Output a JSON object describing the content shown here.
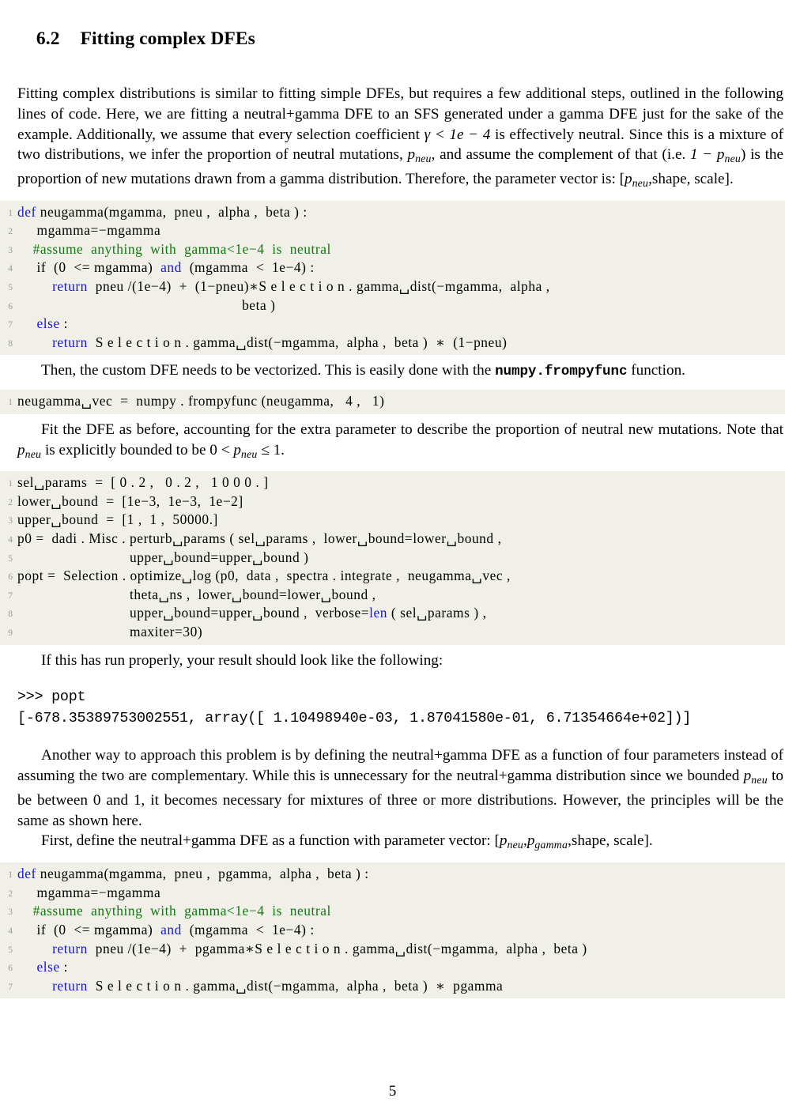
{
  "document": {
    "page_number": "5"
  },
  "section": {
    "number": "6.2",
    "title": "Fitting complex DFEs"
  },
  "paragraphs": {
    "intro_p1": "Fitting complex distributions is similar to fitting simple DFEs, but requires a few additional steps, outlined in the following lines of code.  Here, we are fitting a neutral+gamma DFE to an SFS generated under a gamma DFE just for the sake of the example.  Additionally, we assume that every selection coefficient",
    "intro_p1_math1": "γ < 1e − 4",
    "intro_p1_b": "is effectively neutral.  Since this is a mixture of two distributions, we infer the proportion of neutral mutations,",
    "intro_p1_var1": "p",
    "intro_p1_var1_sub": "neu",
    "intro_p1_c": ", and assume the complement of that (i.e.",
    "intro_p1_math2": "1 − p",
    "intro_p1_math2_sub": "neu",
    "intro_p1_d": ") is the proportion of new mutations drawn from a gamma distribution.  Therefore, the parameter vector is: [",
    "intro_p1_var2": "p",
    "intro_p1_var2_sub": "neu",
    "intro_p1_e": ",shape, scale].",
    "vectorize_a": "Then, the custom DFE needs to be vectorized.  This is easily done with the",
    "vectorize_mono": "numpy.frompyfunc",
    "vectorize_b": "function.",
    "fit_a": "Fit the DFE as before, accounting for the extra parameter to describe the proportion of neutral new mutations.  Note that",
    "fit_var": "p",
    "fit_var_sub": "neu",
    "fit_b": "is explicitly bounded to be 0 <",
    "fit_var2": "p",
    "fit_var2_sub": "neu",
    "fit_c": "≤ 1.",
    "result_lead": "If this has run properly, your result should look like the following:",
    "another_a": "Another way to approach this problem is by defining the neutral+gamma DFE as a function of four parameters instead of assuming the two are complementary.  While this is unnecessary for the neutral+gamma distribution since we bounded",
    "another_var": "p",
    "another_var_sub": "neu",
    "another_b": "to be between 0 and 1, it becomes necessary for mixtures of three or more distributions.  However, the principles will be the same as shown here.",
    "first_a": "First, define the neutral+gamma DFE as a function with parameter vector: [",
    "first_var1": "p",
    "first_var1_sub": "neu",
    "first_sep": ",",
    "first_var2": "p",
    "first_var2_sub": "gamma",
    "first_b": ",shape, scale]."
  },
  "code_blocks": {
    "neugamma3": {
      "lines": [
        {
          "n": "1",
          "segments": [
            {
              "t": "def",
              "c": "kw"
            },
            {
              "t": " neugamma(mgamma,  pneu ,  alpha ,  beta ) :",
              "c": ""
            }
          ]
        },
        {
          "n": "2",
          "segments": [
            {
              "t": "     mgamma=−mgamma",
              "c": ""
            }
          ]
        },
        {
          "n": "3",
          "segments": [
            {
              "t": "    #assume  anything  with  gamma<1e−4  is  neutral",
              "c": "cmt"
            }
          ]
        },
        {
          "n": "4",
          "segments": [
            {
              "t": "     if  (0  <= mgamma)  ",
              "c": ""
            },
            {
              "t": "and",
              "c": "kw"
            },
            {
              "t": "  (mgamma  <  1e−4) :",
              "c": ""
            }
          ]
        },
        {
          "n": "5",
          "segments": [
            {
              "t": "         ",
              "c": ""
            },
            {
              "t": "return",
              "c": "kw"
            },
            {
              "t": "  pneu /(1e−4)  +  (1−pneu)∗S e l e c t i o n . gamma␣dist(−mgamma,  alpha ,",
              "c": ""
            }
          ]
        },
        {
          "n": "6",
          "segments": [
            {
              "t": "                                                          beta )",
              "c": ""
            }
          ]
        },
        {
          "n": "7",
          "segments": [
            {
              "t": "     ",
              "c": ""
            },
            {
              "t": "else",
              "c": "kw"
            },
            {
              "t": " :",
              "c": ""
            }
          ]
        },
        {
          "n": "8",
          "segments": [
            {
              "t": "         ",
              "c": ""
            },
            {
              "t": "return",
              "c": "kw"
            },
            {
              "t": "  S e l e c t i o n . gamma␣dist(−mgamma,  alpha ,  beta )  ∗  (1−pneu)",
              "c": ""
            }
          ]
        }
      ]
    },
    "vectorize": {
      "lines": [
        {
          "n": "1",
          "segments": [
            {
              "t": "neugamma␣vec  =  numpy . frompyfunc (neugamma,   4 ,   1)",
              "c": ""
            }
          ]
        }
      ]
    },
    "optimize": {
      "lines": [
        {
          "n": "1",
          "segments": [
            {
              "t": "sel␣params  =  [ 0 . 2 ,   0 . 2 ,   1 0 0 0 . ]",
              "c": ""
            }
          ]
        },
        {
          "n": "2",
          "segments": [
            {
              "t": "lower␣bound  =  [1e−3,  1e−3,  1e−2]",
              "c": ""
            }
          ]
        },
        {
          "n": "3",
          "segments": [
            {
              "t": "upper␣bound  =  [1 ,  1 ,  50000.]",
              "c": ""
            }
          ]
        },
        {
          "n": "4",
          "segments": [
            {
              "t": "p0 =  dadi . Misc . perturb␣params ( sel␣params ,  lower␣bound=lower␣bound ,",
              "c": ""
            }
          ]
        },
        {
          "n": "5",
          "segments": [
            {
              "t": "                             upper␣bound=upper␣bound )",
              "c": ""
            }
          ]
        },
        {
          "n": "6",
          "segments": [
            {
              "t": "popt =  Selection . optimize␣log (p0,  data ,  spectra . integrate ,  neugamma␣vec ,",
              "c": ""
            }
          ]
        },
        {
          "n": "7",
          "segments": [
            {
              "t": "                             theta␣ns ,  lower␣bound=lower␣bound ,",
              "c": ""
            }
          ]
        },
        {
          "n": "8",
          "segments": [
            {
              "t": "                             upper␣bound=upper␣bound ,  verbose=",
              "c": ""
            },
            {
              "t": "len",
              "c": "bi"
            },
            {
              "t": " ( sel␣params ) ,",
              "c": ""
            }
          ]
        },
        {
          "n": "9",
          "segments": [
            {
              "t": "                             maxiter=30)",
              "c": ""
            }
          ]
        }
      ]
    },
    "neugamma4": {
      "lines": [
        {
          "n": "1",
          "segments": [
            {
              "t": "def",
              "c": "kw"
            },
            {
              "t": " neugamma(mgamma,  pneu ,  pgamma,  alpha ,  beta ) :",
              "c": ""
            }
          ]
        },
        {
          "n": "2",
          "segments": [
            {
              "t": "     mgamma=−mgamma",
              "c": ""
            }
          ]
        },
        {
          "n": "3",
          "segments": [
            {
              "t": "    #assume  anything  with  gamma<1e−4  is  neutral",
              "c": "cmt"
            }
          ]
        },
        {
          "n": "4",
          "segments": [
            {
              "t": "     if  (0  <= mgamma)  ",
              "c": ""
            },
            {
              "t": "and",
              "c": "kw"
            },
            {
              "t": "  (mgamma  <  1e−4) :",
              "c": ""
            }
          ]
        },
        {
          "n": "5",
          "segments": [
            {
              "t": "         ",
              "c": ""
            },
            {
              "t": "return",
              "c": "kw"
            },
            {
              "t": "  pneu /(1e−4)  +  pgamma∗S e l e c t i o n . gamma␣dist(−mgamma,  alpha ,  beta )",
              "c": ""
            }
          ]
        },
        {
          "n": "6",
          "segments": [
            {
              "t": "     ",
              "c": ""
            },
            {
              "t": "else",
              "c": "kw"
            },
            {
              "t": " :",
              "c": ""
            }
          ]
        },
        {
          "n": "7",
          "segments": [
            {
              "t": "         ",
              "c": ""
            },
            {
              "t": "return",
              "c": "kw"
            },
            {
              "t": "  S e l e c t i o n . gamma␣dist(−mgamma,  alpha ,  beta )  ∗  pgamma",
              "c": ""
            }
          ]
        }
      ]
    }
  },
  "terminal": {
    "prompt_line": ">>> popt",
    "output_line": "[-678.35389753002551, array([ 1.10498940e-03, 1.87041580e-01, 6.71354664e+02])]"
  },
  "colors": {
    "code_background": "#f1f0e8",
    "keyword": "#1818d0",
    "comment": "#117711",
    "line_number": "#9a9a96",
    "text": "#000000"
  }
}
